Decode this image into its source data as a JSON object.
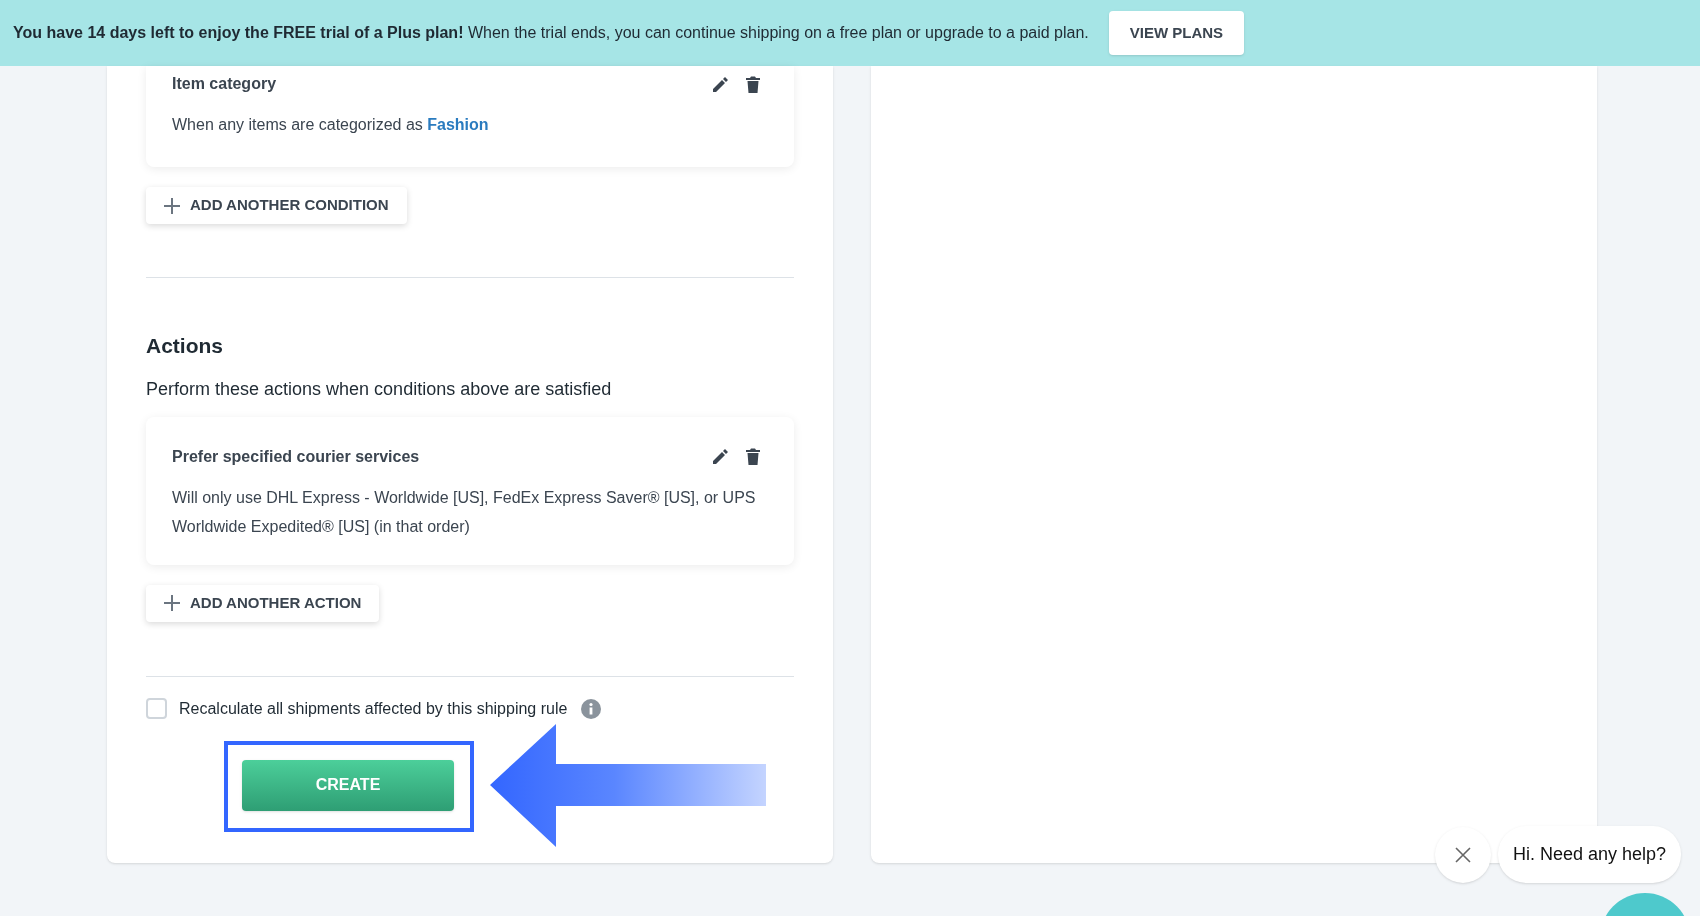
{
  "banner": {
    "message": "**You have 14 days left to enjoy the FREE trial of a Plus plan!** When the trial ends, you can continue shipping on a free plan or upgrade to a paid plan.",
    "button": "VIEW PLANS"
  },
  "conditions": {
    "items": [
      {
        "title": "Item category",
        "description": "When any items are categorized as **Fashion**"
      }
    ],
    "add_button": "ADD ANOTHER CONDITION"
  },
  "actions": {
    "heading": "Actions",
    "subtitle": "Perform these actions when conditions above are satisfied",
    "items": [
      {
        "title": "Prefer specified courier services",
        "description": "Will only use DHL Express - Worldwide [US], FedEx Express Saver® [US], or UPS Worldwide Expedited® [US] (in that order)"
      }
    ],
    "add_button": "ADD ANOTHER ACTION"
  },
  "recalculate": {
    "label": "Recalculate all shipments affected by this shipping rule",
    "checked": false
  },
  "submit_button": "CREATE",
  "chat": {
    "message": "Hi. Need any help?"
  }
}
